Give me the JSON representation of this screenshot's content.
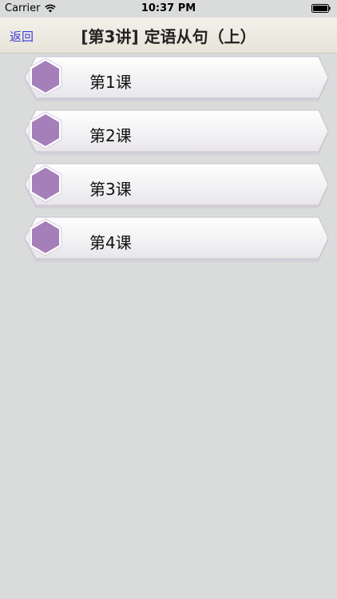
{
  "status": {
    "carrier": "Carrier",
    "time": "10:37 PM"
  },
  "nav": {
    "back_label": "返回",
    "title": "[第3讲] 定语从句（上）"
  },
  "lessons": [
    {
      "label": "第1课"
    },
    {
      "label": "第2课"
    },
    {
      "label": "第3课"
    },
    {
      "label": "第4课"
    }
  ],
  "colors": {
    "hexagon": "#a57fba",
    "back_link": "#3a3ad6"
  }
}
